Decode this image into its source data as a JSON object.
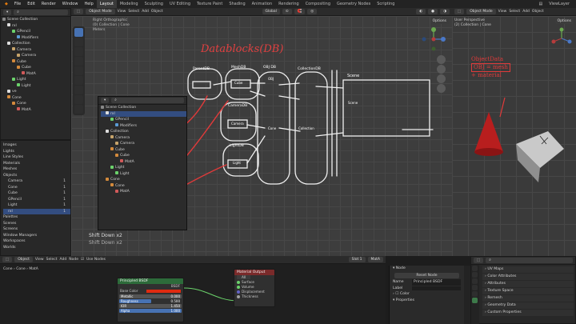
{
  "menus": [
    "File",
    "Edit",
    "Render",
    "Window",
    "Help"
  ],
  "workspaces": [
    "Layout",
    "Modeling",
    "Sculpting",
    "UV Editing",
    "Texture Paint",
    "Shading",
    "Animation",
    "Rendering",
    "Compositing",
    "Geometry Nodes",
    "Scripting"
  ],
  "active_workspace": "Layout",
  "view_layer": "ViewLayer",
  "outliner": {
    "root": "Scene Collection",
    "items": [
      {
        "label": "rxl",
        "depth": 1
      },
      {
        "label": "GPencil",
        "depth": 2
      },
      {
        "label": "Modifiers",
        "depth": 3
      },
      {
        "label": "Collection",
        "depth": 1
      },
      {
        "label": "Camera",
        "depth": 2
      },
      {
        "label": "Camera",
        "depth": 3
      },
      {
        "label": "Cube",
        "depth": 2
      },
      {
        "label": "Cube",
        "depth": 3
      },
      {
        "label": "MatA",
        "depth": 4
      },
      {
        "label": "Light",
        "depth": 2
      },
      {
        "label": "Light",
        "depth": 3
      },
      {
        "label": "ve",
        "depth": 1
      },
      {
        "label": "Cone",
        "depth": 1
      },
      {
        "label": "Cone",
        "depth": 2
      },
      {
        "label": "MatA",
        "depth": 3
      }
    ]
  },
  "blend_file": {
    "items": [
      "Images",
      "Lights",
      "Line Styles",
      "Materials",
      "Meshes",
      "Objects",
      "Camera",
      "Cone",
      "Cube",
      "GPencil",
      "Light",
      "rxl",
      "Palettes",
      "Scenes",
      "Screens",
      "Window Managers",
      "Workspaces",
      "Worlds"
    ],
    "counts": [
      "1",
      "1",
      "1",
      "1",
      "1",
      "1"
    ]
  },
  "viewport_main": {
    "mode": "Object Mode",
    "menus": [
      "View",
      "Select",
      "Add",
      "Object"
    ],
    "transform": "Global",
    "info": [
      "Right Orthographic",
      "(0) Collection | Cone",
      "Meters"
    ],
    "options": "Options",
    "status_lines": [
      "Shift Down x2",
      "Shift Down x2"
    ]
  },
  "drawing": {
    "title": "Datablocks(DB)",
    "labels": [
      "ParentDB",
      "MeshDB",
      "OBJ DB",
      "CollectionDB",
      "Scene",
      "CameraDB",
      "LightDB",
      "Camera",
      "Cube",
      "Light",
      "OBJ",
      "Collection",
      "Scene",
      "Cone"
    ]
  },
  "overlay_outliner": {
    "search_placeholder": "",
    "root": "Scene Collection",
    "items": [
      {
        "label": "rxl",
        "depth": 1
      },
      {
        "label": "GPencil",
        "depth": 2
      },
      {
        "label": "Modifiers",
        "depth": 3
      },
      {
        "label": "Collection",
        "depth": 1
      },
      {
        "label": "Camera",
        "depth": 2
      },
      {
        "label": "Camera",
        "depth": 3
      },
      {
        "label": "Cube",
        "depth": 2
      },
      {
        "label": "Cube",
        "depth": 3
      },
      {
        "label": "MatA",
        "depth": 4
      },
      {
        "label": "Light",
        "depth": 2
      },
      {
        "label": "Light",
        "depth": 3
      },
      {
        "label": "Cone",
        "depth": 1
      },
      {
        "label": "Cone",
        "depth": 2
      },
      {
        "label": "MatA",
        "depth": 3
      }
    ]
  },
  "viewport_right": {
    "mode": "Object Mode",
    "menus": [
      "View",
      "Select",
      "Add",
      "Object"
    ],
    "info": [
      "User Perspective",
      "(2) Collection | Cone"
    ],
    "options": "Options",
    "note": [
      "ObjectData",
      "OBJ = mesh",
      "+ material"
    ]
  },
  "node_editor": {
    "mode": "Object",
    "menus": [
      "View",
      "Select",
      "Add",
      "Node"
    ],
    "use_nodes": "Use Nodes",
    "slot": "Slot 1",
    "material": "MatA",
    "breadcrumb": [
      "Cone",
      "Cone",
      "MatA"
    ],
    "bsdf": {
      "title": "Principled BSDF",
      "output": "BSDF",
      "fields": [
        {
          "label": "Base Color",
          "value": ""
        },
        {
          "label": "Metallic",
          "value": "0.000"
        },
        {
          "label": "Roughness",
          "value": "0.500"
        },
        {
          "label": "IOR",
          "value": "1.450"
        },
        {
          "label": "Alpha",
          "value": "1.000"
        }
      ]
    },
    "output_node": {
      "title": "Material Output",
      "target": "All",
      "inputs": [
        "Surface",
        "Volume",
        "Displacement",
        "Thickness"
      ]
    }
  },
  "node_sidebar": {
    "section": "Node",
    "reset": "Reset Node",
    "name_label": "Name",
    "name_value": "Principled BSDF",
    "label_label": "Label",
    "color": "Color",
    "properties": "Properties"
  },
  "properties": {
    "sections": [
      "UV Maps",
      "Color Attributes",
      "Attributes",
      "Texture Space",
      "Remesh",
      "Geometry Data",
      "Custom Properties"
    ]
  },
  "colors": {
    "accent": "#4772b3",
    "annotation": "#e03a3a",
    "chalk": "#f0f0f0",
    "cone": "#b81e1e",
    "bsdf_header": "#2d6b3a",
    "output_header": "#7a2a2a"
  }
}
